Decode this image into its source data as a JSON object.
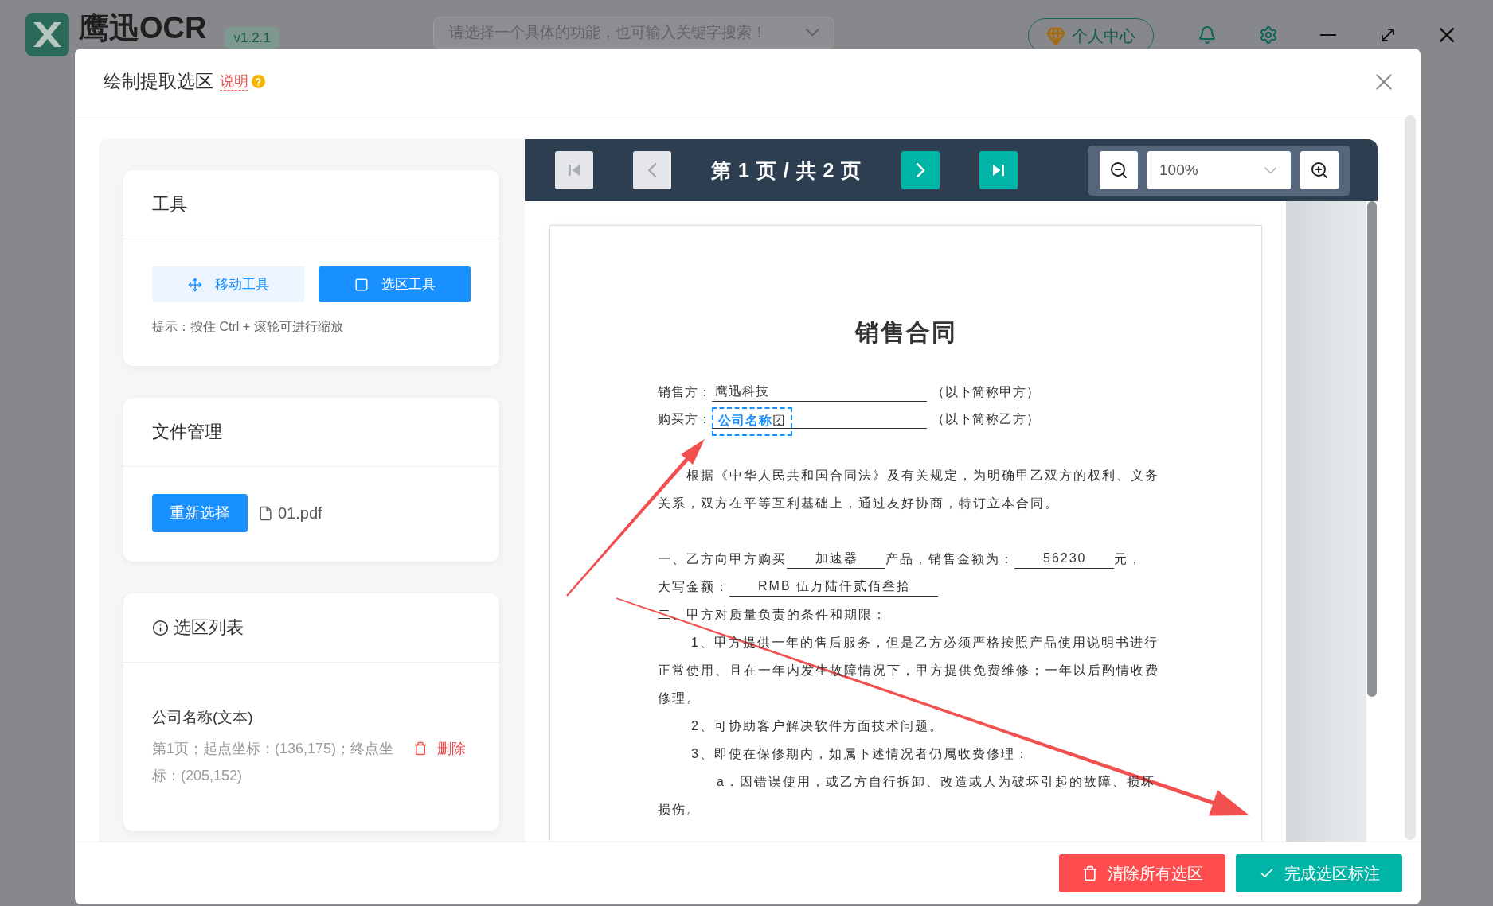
{
  "app": {
    "logo_text": "鹰迅OCR",
    "version": "v1.2.1",
    "search": {
      "placeholder": "请选择一个具体的功能，也可输入关键字搜索！"
    },
    "account_button": "个人中心"
  },
  "dialog": {
    "title": "绘制提取选区",
    "help_link": "说明",
    "tools_card": {
      "title": "工具",
      "tools": [
        {
          "kind": "move",
          "label": "移动工具",
          "selected": false
        },
        {
          "kind": "select",
          "label": "选区工具",
          "selected": true
        }
      ],
      "hint": "提示：按住 Ctrl + 滚轮可进行缩放"
    },
    "file_card": {
      "title": "文件管理",
      "button": "重新选择",
      "file_name": "01.pdf"
    },
    "selection_card": {
      "title": "选区列表",
      "items": [
        {
          "name": "公司名称(文本)",
          "detail": "第1页；起点坐标：(136,175)；终点坐标：(205,152)",
          "delete": "删除"
        }
      ]
    },
    "viewer": {
      "nav_buttons": [
        {
          "kind": "first",
          "disabled": true
        },
        {
          "kind": "prev",
          "disabled": true
        },
        {
          "kind": "next",
          "disabled": false
        },
        {
          "kind": "last",
          "disabled": false
        }
      ],
      "page_label": "第 1 页 / 共 2 页",
      "zoom": "100%",
      "document": {
        "title": "销售合同",
        "parties": [
          {
            "label": "销售方：",
            "value": "鹰迅科技",
            "note": "（以下简称甲方）"
          },
          {
            "label": "购买方：",
            "selection_label": "公司名称",
            "value": "团",
            "note": "（以下简称乙方）"
          }
        ],
        "lines": [
          {
            "kind": "para",
            "parts": [
              {
                "kind": "text",
                "text": "根据《中华人民共和国合同法》及有关规定，为明确甲乙双方的权利、义务"
              }
            ]
          },
          {
            "kind": "plain",
            "parts": [
              {
                "kind": "text",
                "text": "关系，双方在平等互利基础上，通过友好协商，特订立本合同。"
              }
            ]
          },
          {
            "kind": "section",
            "parts": [
              {
                "kind": "text",
                "text": "一、乙方向甲方购买"
              },
              {
                "kind": "fill",
                "text": "加速器"
              },
              {
                "kind": "text",
                "text": "产品，销售金额为："
              },
              {
                "kind": "fill",
                "text": "56230"
              },
              {
                "kind": "text",
                "text": "元，"
              }
            ]
          },
          {
            "kind": "plain",
            "parts": [
              {
                "kind": "text",
                "text": "大写金额："
              },
              {
                "kind": "fill",
                "text": "RMB 伍万陆仟贰佰叁拾"
              }
            ]
          },
          {
            "kind": "plain",
            "parts": [
              {
                "kind": "text",
                "text": "二、甲方对质量负责的条件和期限："
              }
            ]
          },
          {
            "kind": "item",
            "parts": [
              {
                "kind": "text",
                "text": "1、甲方提供一年的售后服务，但是乙方必须严格按照产品使用说明书进行"
              }
            ]
          },
          {
            "kind": "plain",
            "parts": [
              {
                "kind": "text",
                "text": "正常使用、且在一年内发生故障情况下，甲方提供免费维修；一年以后酌情收费"
              }
            ]
          },
          {
            "kind": "plain",
            "parts": [
              {
                "kind": "text",
                "text": "修理。"
              }
            ]
          },
          {
            "kind": "item",
            "parts": [
              {
                "kind": "text",
                "text": "2、可协助客户解决软件方面技术问题。"
              }
            ]
          },
          {
            "kind": "item",
            "parts": [
              {
                "kind": "text",
                "text": "3、即使在保修期内，如属下述情况者仍属收费修理："
              }
            ]
          },
          {
            "kind": "subitem",
            "parts": [
              {
                "kind": "text",
                "text": "a．因错误使用，或乙方自行拆卸、改造或人为破坏引起的故障、损坏"
              }
            ]
          },
          {
            "kind": "plain",
            "parts": [
              {
                "kind": "text",
                "text": "损伤。"
              }
            ]
          }
        ]
      }
    },
    "footer_buttons": [
      {
        "kind": "clear",
        "label": "清除所有选区"
      },
      {
        "kind": "done",
        "label": "完成选区标注"
      }
    ]
  }
}
